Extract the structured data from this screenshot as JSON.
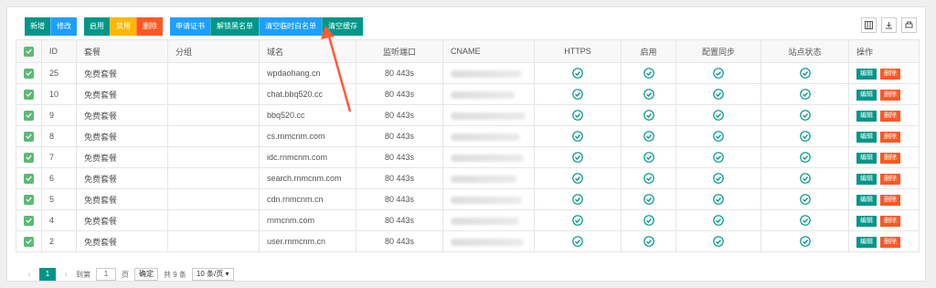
{
  "toolbar": {
    "add": "新增",
    "edit": "修改",
    "enable": "启用",
    "disable": "禁用",
    "delete": "删除",
    "apply_cert": "申请证书",
    "unban": "解锁黑名单",
    "clear_whitelist": "清空临时白名单",
    "clear_cache": "清空缓存"
  },
  "columns": [
    "ID",
    "套餐",
    "分组",
    "域名",
    "监听端口",
    "CNAME",
    "HTTPS",
    "启用",
    "配置同步",
    "站点状态",
    "操作"
  ],
  "rows": [
    {
      "id": "25",
      "plan": "免费套餐",
      "domain": "wpdaohang.cn",
      "ports": "80 443s"
    },
    {
      "id": "10",
      "plan": "免费套餐",
      "domain": "chat.bbq520.cc",
      "ports": "80 443s"
    },
    {
      "id": "9",
      "plan": "免费套餐",
      "domain": "bbq520.cc",
      "ports": "80 443s"
    },
    {
      "id": "8",
      "plan": "免费套餐",
      "domain": "cs.rnmcnm.com",
      "ports": "80 443s"
    },
    {
      "id": "7",
      "plan": "免费套餐",
      "domain": "idc.rnmcnm.com",
      "ports": "80 443s"
    },
    {
      "id": "6",
      "plan": "免费套餐",
      "domain": "search.rnmcnm.com",
      "ports": "80 443s"
    },
    {
      "id": "5",
      "plan": "免费套餐",
      "domain": "cdn.rnmcnm.cn",
      "ports": "80 443s"
    },
    {
      "id": "4",
      "plan": "免费套餐",
      "domain": "rnmcnm.com",
      "ports": "80 443s"
    },
    {
      "id": "2",
      "plan": "免费套餐",
      "domain": "user.rnmcnm.cn",
      "ports": "80 443s"
    }
  ],
  "row_actions": {
    "edit": "编辑",
    "delete": "删除"
  },
  "pager": {
    "current": "1",
    "goto": "到第",
    "page_input": "1",
    "page_unit": "页",
    "confirm": "确定",
    "total": "共 9 条",
    "per_page": "10 条/页"
  },
  "colors": {
    "teal": "#009688",
    "blue": "#1e9fff",
    "yellow": "#ffb800",
    "red": "#ff5722",
    "check": "#5fb878",
    "annotation_arrow": "#ff5a3c"
  }
}
